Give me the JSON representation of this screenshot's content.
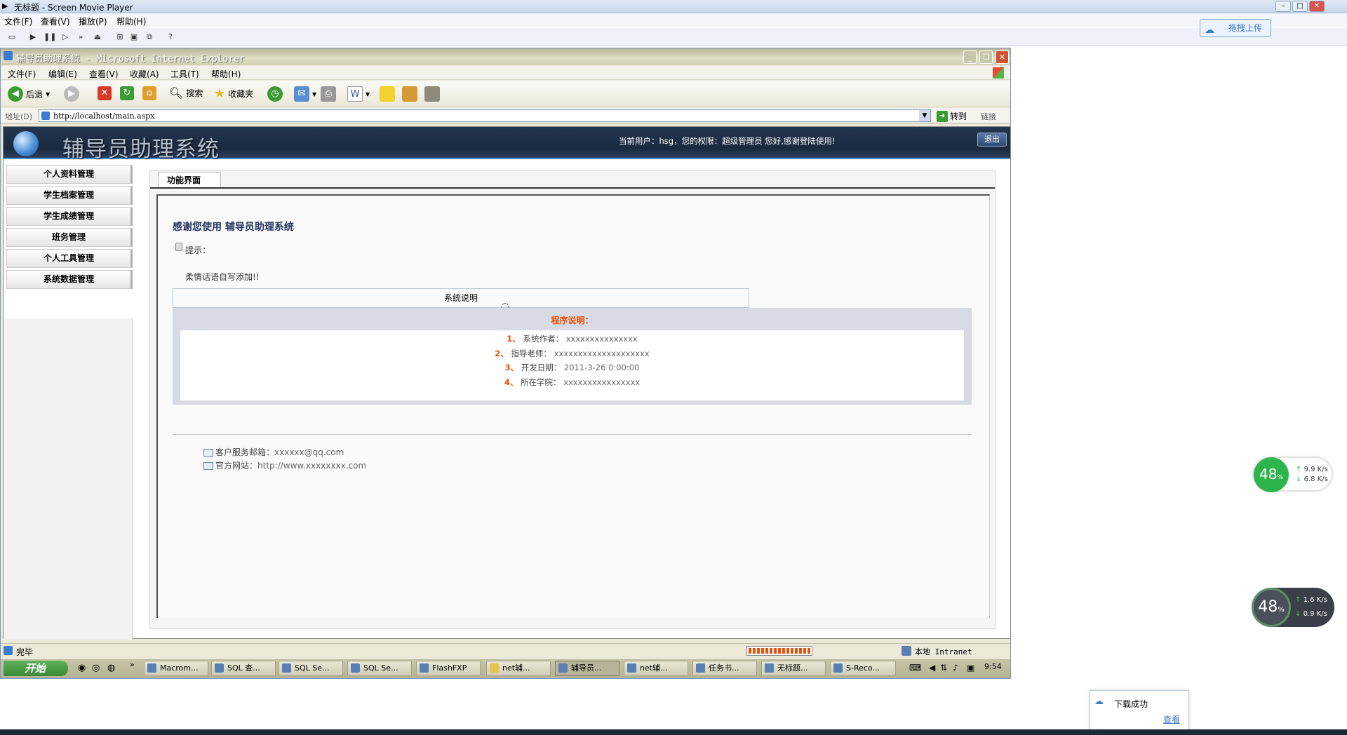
{
  "player": {
    "title": "无标题 - Screen Movie Player",
    "menu": [
      "文件(F)",
      "查看(V)",
      "播放(P)",
      "帮助(H)"
    ],
    "upload_label": "拖拽上传"
  },
  "ie": {
    "title": "辅导员助理系统 - Microsoft Internet Explorer",
    "menu": [
      "文件(F)",
      "编辑(E)",
      "查看(V)",
      "收藏(A)",
      "工具(T)",
      "帮助(H)"
    ],
    "toolbar": {
      "back": "后退",
      "search": "搜索",
      "favorites": "收藏夹"
    },
    "address_label": "地址(D)",
    "url": "http://localhost/main.aspx",
    "go": "转到",
    "links": "链接",
    "status": "完毕",
    "zone": "本地 Intranet"
  },
  "site": {
    "logo": "辅导员助理系统",
    "user_info": "当前用户：hsg，您的权限：超级管理员 您好,感谢登陆使用!",
    "logout": "退出",
    "sidebar": [
      "个人资料管理",
      "学生档案管理",
      "学生成绩管理",
      "班务管理",
      "个人工具管理",
      "系统数据管理"
    ],
    "tab": "功能界面",
    "welcome": "感谢您使用 辅导员助理系统",
    "tip_label": "提示：",
    "tip_text": "柔情话语自写添加!!",
    "sys_header": "系统说明",
    "program_title": "程序说明：",
    "rows": [
      {
        "num": "1、",
        "label": "系统作者：",
        "value": "xxxxxxxxxxxxxxx"
      },
      {
        "num": "2、",
        "label": "指导老师：",
        "value": "xxxxxxxxxxxxxxxxxxxx"
      },
      {
        "num": "3、",
        "label": "开发日期：",
        "value": "2011-3-26 0:00:00"
      },
      {
        "num": "4、",
        "label": "所在学院：",
        "value": "xxxxxxxxxxxxxxxx"
      }
    ],
    "contact": {
      "email_label": "客户服务邮箱：",
      "email": "xxxxxx@qq.com",
      "site_label": "官方网站：",
      "site": "http://www.xxxxxxxx.com"
    }
  },
  "taskbar": {
    "start": "开始",
    "tasks": [
      "Macrom...",
      "SQL 查...",
      "SQL Se...",
      "SQL Se...",
      "FlashFXP",
      "net辅...",
      "辅导员...",
      "net辅...",
      "任务书...",
      "无标题...",
      "S-Reco..."
    ],
    "clock": "9:54"
  },
  "widgets": {
    "net1": {
      "percent": "48",
      "up": "9.9 K/s",
      "down": "6.8 K/s"
    },
    "net2": {
      "percent": "48",
      "up": "1.6 K/s",
      "down": "0.9 K/s"
    },
    "download_text": "下载成功",
    "download_link": "查看"
  }
}
